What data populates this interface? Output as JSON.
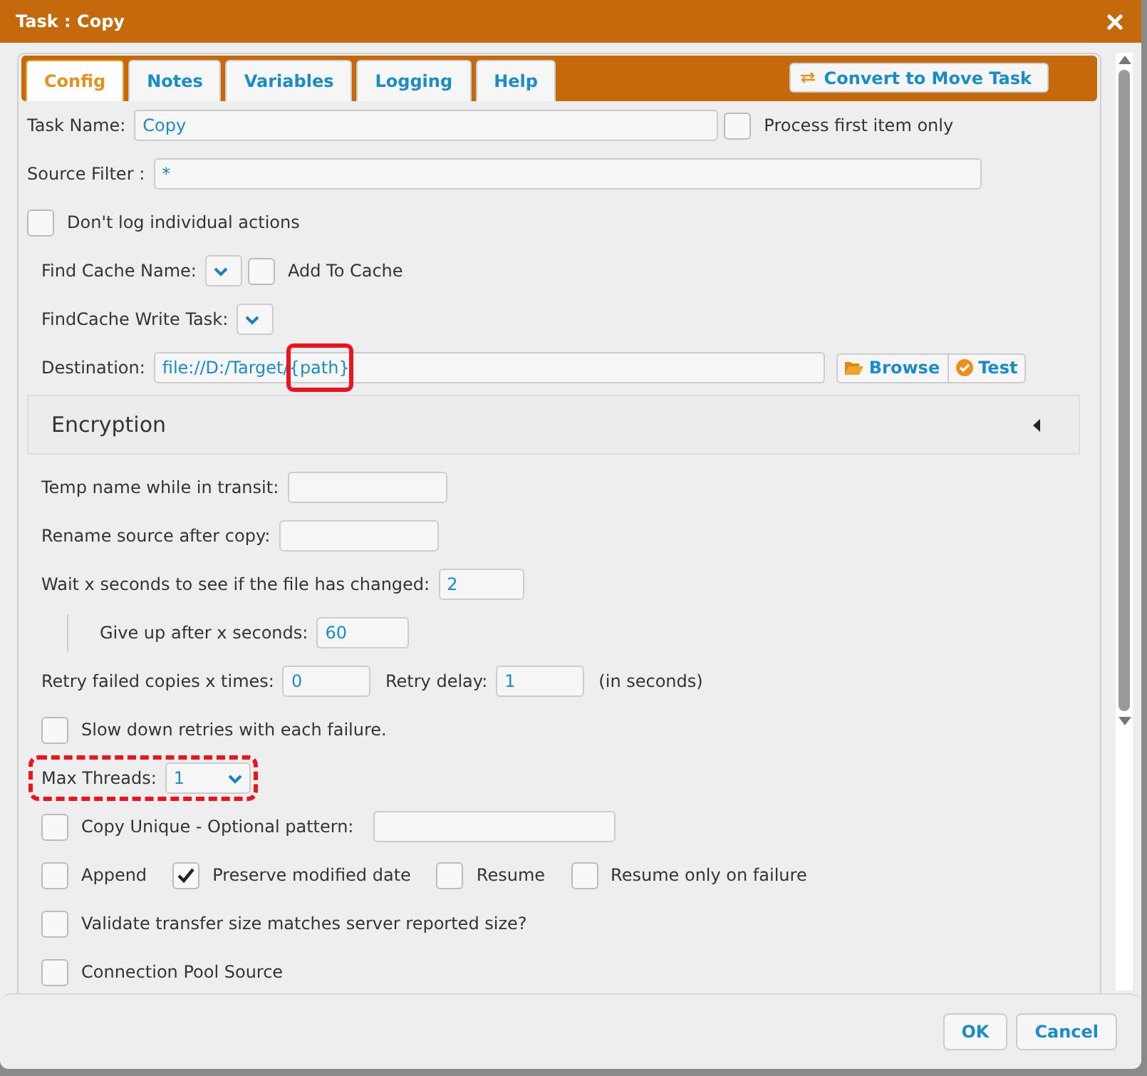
{
  "window": {
    "title": "Task : Copy"
  },
  "tabs": [
    {
      "label": "Config",
      "selected": true
    },
    {
      "label": "Notes",
      "selected": false
    },
    {
      "label": "Variables",
      "selected": false
    },
    {
      "label": "Logging",
      "selected": false
    },
    {
      "label": "Help",
      "selected": false
    }
  ],
  "convert_button": {
    "label": "Convert to Move Task"
  },
  "rows": [
    {
      "kind": "top",
      "items": [
        {
          "kind": "label",
          "text": "Task Name:"
        },
        {
          "kind": "input",
          "value": "Copy"
        },
        {
          "kind": "checkbox",
          "label": "Process first item only",
          "checked": false
        }
      ]
    },
    {
      "kind": "top",
      "items": [
        {
          "kind": "label",
          "text": "Source Filter :"
        },
        {
          "kind": "input",
          "value": "*"
        }
      ]
    },
    {
      "kind": "top",
      "items": [
        {
          "kind": "checkbox",
          "label": "Don't log individual actions",
          "checked": false
        }
      ]
    },
    {
      "kind": "option",
      "items": [
        {
          "kind": "label",
          "text": "Find Cache Name:"
        },
        {
          "kind": "select"
        },
        {
          "kind": "checkbox",
          "label": "Add To Cache",
          "checked": false
        }
      ]
    },
    {
      "kind": "option",
      "items": [
        {
          "kind": "label",
          "text": "FindCache Write Task:"
        },
        {
          "kind": "select"
        }
      ]
    },
    {
      "kind": "option",
      "items": [
        {
          "kind": "label",
          "text": "Destination:"
        },
        {
          "kind": "input",
          "value": "file://D:/Target/{path}",
          "highlighted": true
        },
        {
          "kind": "buttons",
          "buttons": [
            {
              "label": "Browse"
            },
            {
              "label": "Test"
            }
          ]
        }
      ]
    },
    {
      "kind": "section",
      "title": "Encryption",
      "expanded": false
    },
    {
      "kind": "option",
      "items": [
        {
          "kind": "label",
          "text": "Temp name while in transit:"
        },
        {
          "kind": "input"
        }
      ]
    },
    {
      "kind": "option",
      "items": [
        {
          "kind": "label",
          "text": "Rename source after copy:"
        },
        {
          "kind": "input"
        }
      ]
    },
    {
      "kind": "option",
      "items": [
        {
          "kind": "label",
          "text": "Wait x seconds to see if the file has changed:"
        },
        {
          "kind": "input",
          "value": "2"
        }
      ]
    },
    {
      "kind": "nested",
      "items": [
        {
          "kind": "label",
          "text": "Give up after x seconds:"
        },
        {
          "kind": "input",
          "value": "60"
        }
      ]
    },
    {
      "kind": "option",
      "items": [
        {
          "kind": "label",
          "text": "Retry failed copies x times:"
        },
        {
          "kind": "input",
          "value": "0"
        },
        {
          "kind": "label",
          "text": "Retry delay:"
        },
        {
          "kind": "input",
          "value": "1"
        },
        {
          "kind": "label",
          "text": "(in seconds)"
        }
      ]
    },
    {
      "kind": "option",
      "items": [
        {
          "kind": "checkbox",
          "label": "Slow down retries with each failure.",
          "checked": false
        }
      ]
    },
    {
      "kind": "option",
      "highlighted": true,
      "items": [
        {
          "kind": "label",
          "text": "Max Threads:"
        },
        {
          "kind": "select",
          "value": "1"
        }
      ]
    },
    {
      "kind": "option",
      "items": [
        {
          "kind": "checkbox",
          "label": "Copy Unique - Optional pattern:",
          "checked": false
        },
        {
          "kind": "input"
        }
      ]
    },
    {
      "kind": "option",
      "items": [
        {
          "kind": "checkbox",
          "label": "Append",
          "checked": false
        },
        {
          "kind": "checkbox",
          "label": "Preserve modified date",
          "checked": true
        },
        {
          "kind": "checkbox",
          "label": "Resume",
          "checked": false
        },
        {
          "kind": "checkbox",
          "label": "Resume only on failure",
          "checked": false
        }
      ]
    },
    {
      "kind": "option",
      "items": [
        {
          "kind": "checkbox",
          "label": "Validate transfer size matches server reported size?",
          "checked": false
        }
      ]
    },
    {
      "kind": "option",
      "items": [
        {
          "kind": "checkbox",
          "label": "Connection Pool Source",
          "checked": false
        }
      ]
    }
  ],
  "footer_buttons": [
    {
      "label": "OK"
    },
    {
      "label": "Cancel"
    }
  ]
}
